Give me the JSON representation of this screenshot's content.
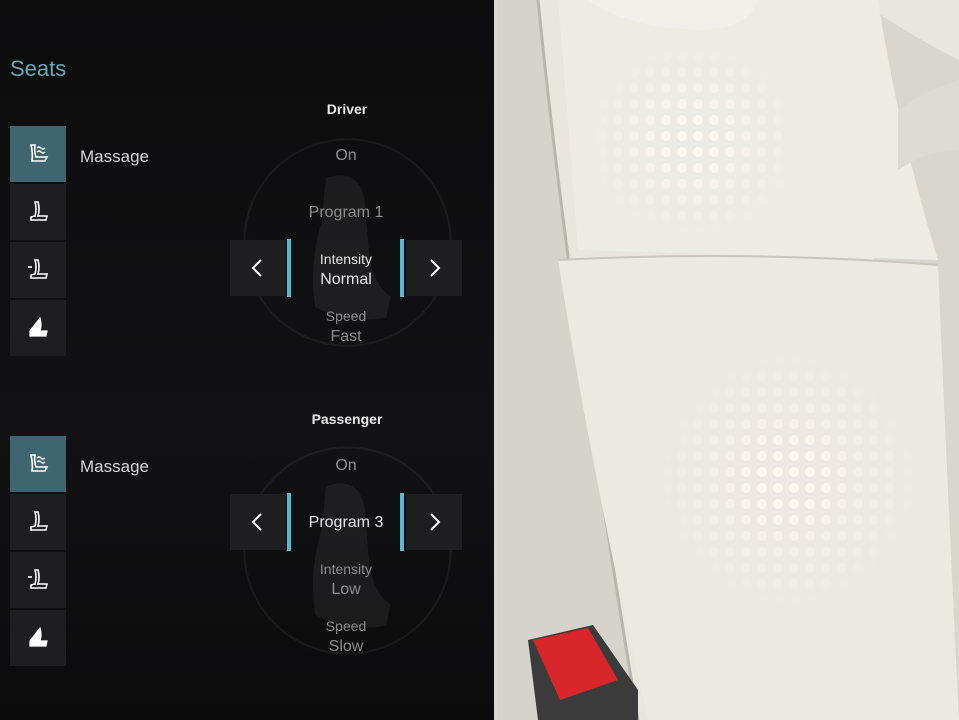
{
  "screen": {
    "title": "Seats",
    "accent_color": "#5ab8d4",
    "active_color": "#3f6670"
  },
  "driver": {
    "heading": "Driver",
    "massage_label": "Massage",
    "massage_value": "On",
    "program": "Program 1",
    "intensity_label": "Intensity",
    "intensity_value": "Normal",
    "speed_label": "Speed",
    "speed_value": "Fast",
    "selected_row": "intensity",
    "side_icons": [
      "massage-seat-icon",
      "seat-icon",
      "seat-adjust-icon",
      "seat-heat-icon"
    ]
  },
  "passenger": {
    "heading": "Passenger",
    "massage_label": "Massage",
    "massage_value": "On",
    "program": "Program 3",
    "intensity_label": "Intensity",
    "intensity_value": "Low",
    "speed_label": "Speed",
    "speed_value": "Slow",
    "selected_row": "program",
    "side_icons": [
      "massage-seat-icon",
      "seat-icon",
      "seat-adjust-icon",
      "seat-heat-icon"
    ]
  },
  "nav": {
    "prev_icon": "chevron-left-icon",
    "next_icon": "chevron-right-icon"
  },
  "photo": {
    "subject": "seat-cushion-photo",
    "buckle_color": "#d8262b"
  }
}
